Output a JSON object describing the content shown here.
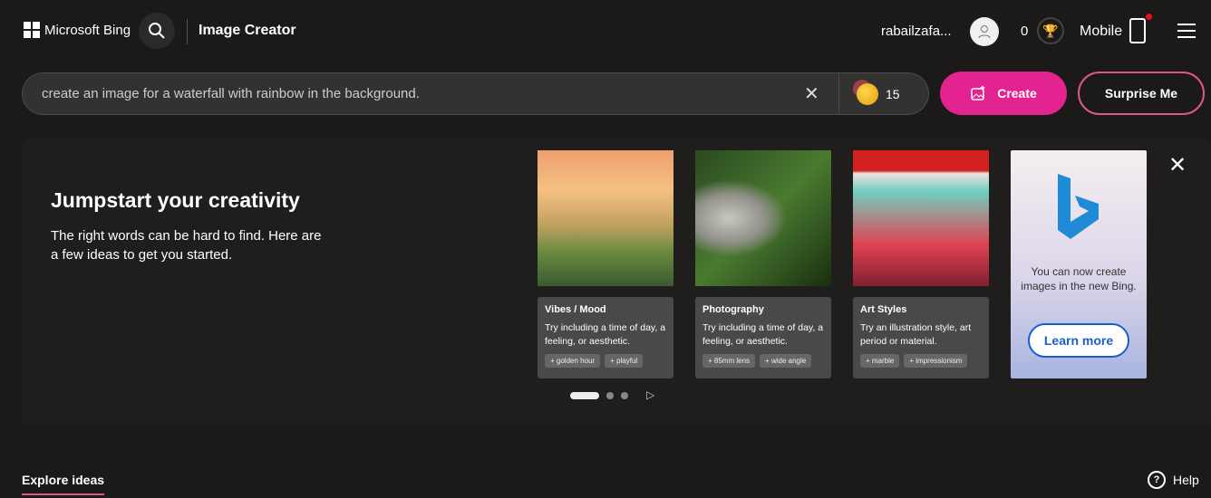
{
  "header": {
    "brand": "Microsoft Bing",
    "title": "Image Creator",
    "user": "rabailzafa...",
    "points": "0",
    "mobile": "Mobile"
  },
  "search": {
    "query": "create an image for a waterfall with rainbow in the background.",
    "boosts": "15",
    "create_label": "Create",
    "surprise_label": "Surprise Me"
  },
  "jumpstart": {
    "heading": "Jumpstart your creativity",
    "text": "The right words can be hard to find. Here are a few ideas to get you started.",
    "cards": [
      {
        "title": "Vibes / Mood",
        "desc": "Try including a time of day, a feeling, or aesthetic.",
        "chips": [
          "golden hour",
          "playful"
        ]
      },
      {
        "title": "Photography",
        "desc": "Try including a time of day, a feeling, or aesthetic.",
        "chips": [
          "85mm lens",
          "wide angle"
        ]
      },
      {
        "title": "Art Styles",
        "desc": "Try an illustration style, art period or material.",
        "chips": [
          "marble",
          "impressionism"
        ]
      }
    ],
    "promo": {
      "text": "You can now create images in the new Bing.",
      "button": "Learn more"
    }
  },
  "footer": {
    "explore": "Explore ideas",
    "help": "Help"
  },
  "colors": {
    "accent": "#e3238f",
    "background": "#1b1a19",
    "learn_more": "#1a5fc9"
  }
}
